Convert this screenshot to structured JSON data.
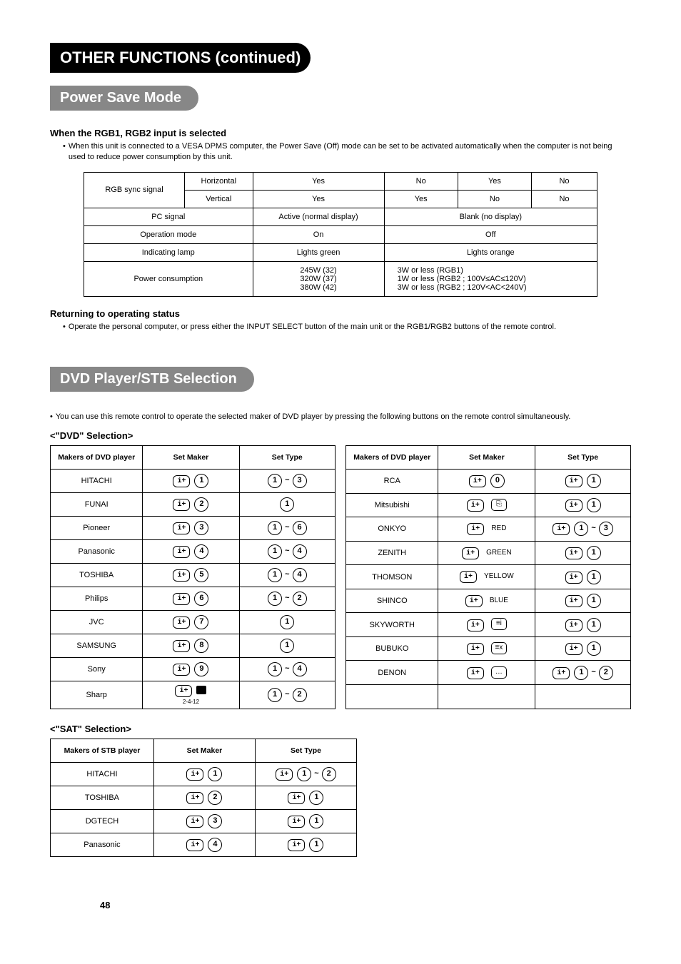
{
  "header": {
    "title": "OTHER FUNCTIONS (continued)"
  },
  "powerSave": {
    "title": "Power Save Mode",
    "sub1": "When the RGB1, RGB2 input is selected",
    "note1": "When this unit is connected to a VESA DPMS computer, the Power Save (Off) mode can be set to be activated automatically when the computer is not being used to reduce power consumption by this unit.",
    "table": {
      "rows": {
        "syncLabel": "RGB sync signal",
        "horiz": "Horizontal",
        "vert": "Vertical",
        "hYes": "Yes",
        "hNo": "No",
        "hYes2": "Yes",
        "hNo2": "No",
        "vYes": "Yes",
        "vYes2": "Yes",
        "vNo": "No",
        "vNo2": "No",
        "pcLabel": "PC signal",
        "pcActive": "Active (normal display)",
        "pcBlank": "Blank (no display)",
        "opLabel": "Operation mode",
        "opOn": "On",
        "opOff": "Off",
        "lampLabel": "Indicating lamp",
        "lampGreen": "Lights green",
        "lampOrange": "Lights orange",
        "powLabel": "Power consumption",
        "powOn": "245W (32)\n320W (37)\n380W (42)",
        "powOff": "3W or less (RGB1)\n  1W or less (RGB2 ; 100V≤AC≤120V)\n  3W or less (RGB2 ; 120V<AC<240V)"
      }
    },
    "sub2": "Returning to operating status",
    "note2": "Operate the personal computer, or press either the INPUT SELECT button of the main unit or the RGB1/RGB2 buttons of the remote control."
  },
  "dvd": {
    "title": "DVD Player/STB Selection",
    "note": "You can use this remote control to operate the selected maker of DVD player by pressing the following buttons on the remote control simultaneously.",
    "dvdHeading": "<\"DVD\" Selection>",
    "cols": {
      "maker": "Makers of DVD player",
      "setMaker": "Set Maker",
      "setType": "Set Type"
    },
    "left": [
      {
        "maker": "HITACHI",
        "sm": "1",
        "st": "1~3"
      },
      {
        "maker": "FUNAI",
        "sm": "2",
        "st": "1"
      },
      {
        "maker": "Pioneer",
        "sm": "3",
        "st": "1~6"
      },
      {
        "maker": "Panasonic",
        "sm": "4",
        "st": "1~4"
      },
      {
        "maker": "TOSHIBA",
        "sm": "5",
        "st": "1~4"
      },
      {
        "maker": "Philips",
        "sm": "6",
        "st": "1~2"
      },
      {
        "maker": "JVC",
        "sm": "7",
        "st": "1"
      },
      {
        "maker": "SAMSUNG",
        "sm": "8",
        "st": "1"
      },
      {
        "maker": "Sony",
        "sm": "9",
        "st": "1~4"
      },
      {
        "maker": "Sharp",
        "sm": "■",
        "smNote": "2-4-12",
        "st": "1~2"
      }
    ],
    "right": [
      {
        "maker": "RCA",
        "smWord": "0",
        "st": "1"
      },
      {
        "maker": "Mitsubishi",
        "smGlyph": "⎘",
        "st": "1"
      },
      {
        "maker": "ONKYO",
        "smWord": "RED",
        "st": "1~3"
      },
      {
        "maker": "ZENITH",
        "smWord": "GREEN",
        "st": "1"
      },
      {
        "maker": "THOMSON",
        "smWord": "YELLOW",
        "st": "1"
      },
      {
        "maker": "SHINCO",
        "smWord": "BLUE",
        "st": "1"
      },
      {
        "maker": "SKYWORTH",
        "smGlyph": "≡i",
        "st": "1"
      },
      {
        "maker": "BUBUKO",
        "smGlyph": "≡x",
        "st": "1"
      },
      {
        "maker": "DENON",
        "smGlyph": "…",
        "st": "1~2"
      }
    ],
    "satHeading": "<\"SAT\" Selection>",
    "satCols": {
      "maker": "Makers of STB player",
      "setMaker": "Set Maker",
      "setType": "Set Type"
    },
    "sat": [
      {
        "maker": "HITACHI",
        "sm": "1",
        "st": "1~2"
      },
      {
        "maker": "TOSHIBA",
        "sm": "2",
        "st": "1"
      },
      {
        "maker": "DGTECH",
        "sm": "3",
        "st": "1"
      },
      {
        "maker": "Panasonic",
        "sm": "4",
        "st": "1"
      }
    ]
  },
  "pageNumber": "48"
}
